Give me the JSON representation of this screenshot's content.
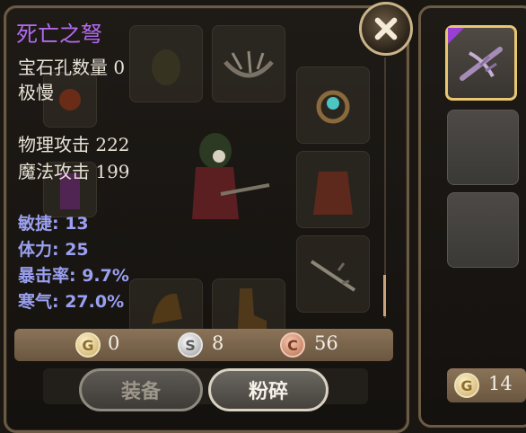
{
  "item": {
    "name": "死亡之弩",
    "lines": [
      "宝石孔数量 0",
      "极慢"
    ],
    "attack": [
      "物理攻击 222",
      "魔法攻击 199"
    ],
    "bonus": [
      "敏捷: 13",
      "体力: 25",
      "暴击率: 9.7%",
      "寒气: 27.0%"
    ],
    "name_color": "#b36bf0",
    "bonus_color": "#9aa0f0"
  },
  "currency": {
    "gold": {
      "symbol": "G",
      "value": "0"
    },
    "silver": {
      "symbol": "S",
      "value": "8"
    },
    "copper": {
      "symbol": "C",
      "value": "56"
    }
  },
  "buttons": {
    "equip": "装备",
    "smash": "粉碎"
  },
  "side": {
    "gold": {
      "symbol": "G",
      "value": "14"
    }
  },
  "icons": [
    "close-icon",
    "crossbow-icon",
    "gold-coin-icon",
    "silver-coin-icon",
    "copper-coin-icon"
  ]
}
